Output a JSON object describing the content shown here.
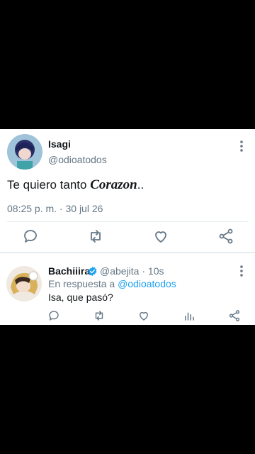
{
  "main_tweet": {
    "display_name": "Isagi",
    "handle": "@odioatodos",
    "text_plain": "Te quiero tanto ",
    "text_emph": "Corazon",
    "text_tail": "..",
    "timestamp": "08:25 p. m. · 30 jul 26"
  },
  "reply_tweet": {
    "display_name": "Bachiiira",
    "handle_time": "@abejita · 10s",
    "reply_prefix": "En respuesta a ",
    "reply_mention": "@odioatodos",
    "text": "Isa, que pasó?"
  },
  "colors": {
    "accent": "#1da1f2",
    "muted": "#657786",
    "text": "#14171a"
  },
  "icons": {
    "actions": [
      "comment-icon",
      "retweet-icon",
      "like-icon",
      "share-icon"
    ],
    "reply_actions": [
      "comment-icon",
      "retweet-icon",
      "like-icon",
      "stats-icon",
      "share-icon"
    ]
  }
}
